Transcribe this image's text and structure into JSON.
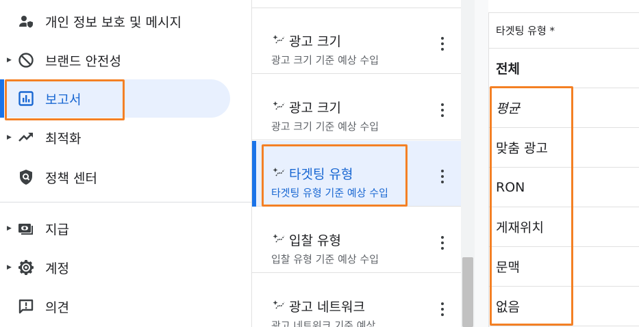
{
  "sidebar": {
    "items": [
      {
        "label": "개인 정보 보호 및 메시지",
        "icon": "person-shield-icon",
        "expandable": false
      },
      {
        "label": "브랜드 안전성",
        "icon": "block-icon",
        "expandable": true
      },
      {
        "label": "보고서",
        "icon": "bar-chart-icon",
        "expandable": false,
        "active": true
      },
      {
        "label": "최적화",
        "icon": "trending-up-icon",
        "expandable": true
      },
      {
        "label": "정책 센터",
        "icon": "policy-shield-icon",
        "expandable": false
      },
      {
        "label": "지급",
        "icon": "payments-icon",
        "expandable": true
      },
      {
        "label": "계정",
        "icon": "gear-icon",
        "expandable": true
      },
      {
        "label": "의견",
        "icon": "feedback-icon",
        "expandable": false
      }
    ]
  },
  "report_list": {
    "cards": [
      {
        "title": "광고 크기",
        "subtitle": "광고 크기 기준 예상 수입"
      },
      {
        "title": "광고 크기",
        "subtitle": "광고 크기 기준 예상 수입"
      },
      {
        "title": "타겟팅 유형",
        "subtitle": "타겟팅 유형 기준 예상 수입",
        "selected": true
      },
      {
        "title": "입찰 유형",
        "subtitle": "입찰 유형 기준 예상 수입"
      },
      {
        "title": "광고 네트워크",
        "subtitle": "광고 네트워크 기준 예상 ..."
      }
    ]
  },
  "table": {
    "header": "타겟팅 유형 *",
    "rows": [
      "전체",
      "평균",
      "맞춤 광고",
      "RON",
      "게재위치",
      "문맥",
      "없음"
    ]
  },
  "colors": {
    "accent": "#1a73e8",
    "highlight": "#f48024",
    "selected_bg": "#e8f0fe"
  }
}
